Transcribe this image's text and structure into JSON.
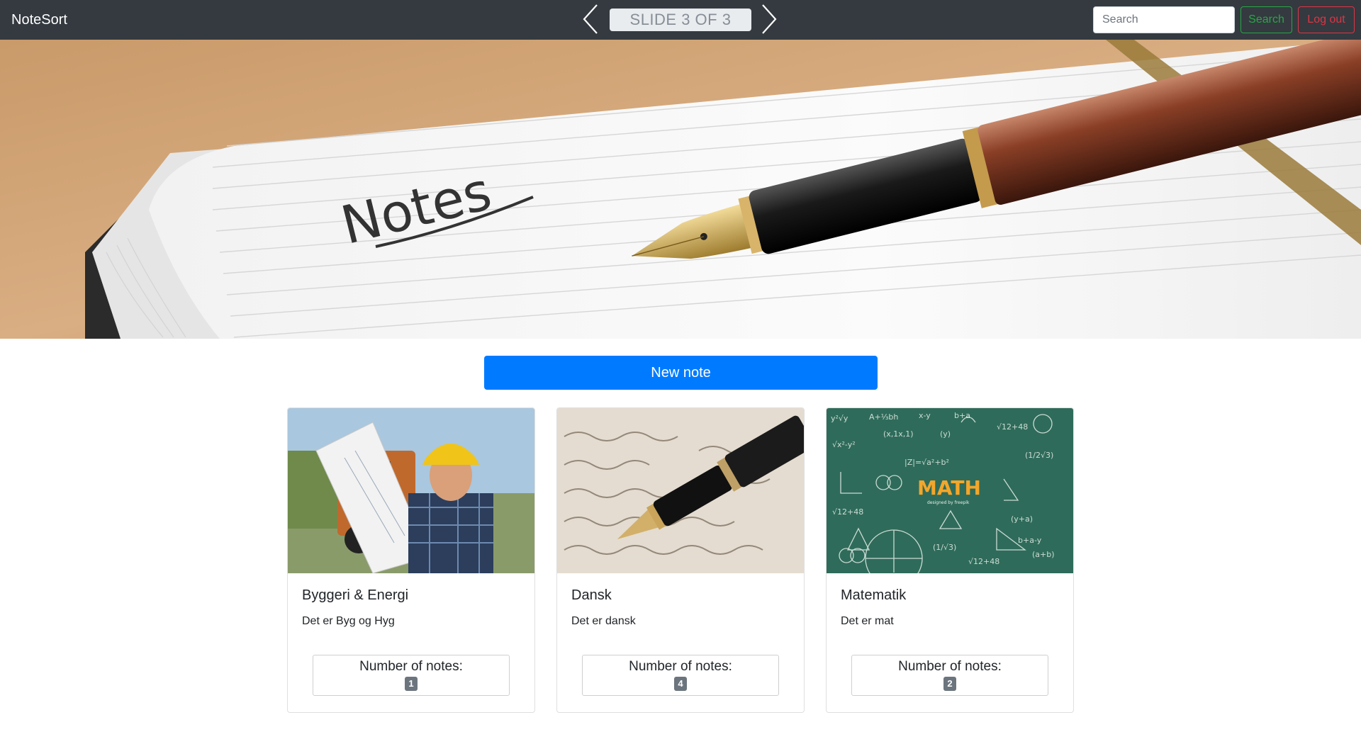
{
  "navbar": {
    "brand": "NoteSort",
    "slide_indicator": "SLIDE 3 OF 3",
    "search_placeholder": "Search",
    "search_button": "Search",
    "logout_button": "Log out",
    "prev_icon": "chevron-left-icon",
    "next_icon": "chevron-right-icon"
  },
  "hero": {
    "image": "notebook with handwritten 'Notes' and fountain pen",
    "handwriting": "Notes"
  },
  "actions": {
    "new_note": "New note"
  },
  "cards": [
    {
      "title": "Byggeri & Energi",
      "description": "Det er Byg og Hyg",
      "count_label": "Number of notes:",
      "count": "1",
      "image": "construction worker with blueprints"
    },
    {
      "title": "Dansk",
      "description": "Det er dansk",
      "count_label": "Number of notes:",
      "count": "4",
      "image": "fountain pen on handwritten letter"
    },
    {
      "title": "Matematik",
      "description": "Det er mat",
      "count_label": "Number of notes:",
      "count": "2",
      "image": "green chalkboard math formulas",
      "image_text": "MATH",
      "image_credit": "designed by freepik"
    }
  ],
  "colors": {
    "navbar_bg": "#343a40",
    "primary": "#007bff",
    "success": "#28a745",
    "danger": "#dc3545",
    "badge": "#6c757d",
    "chalkboard": "#2f6b5a"
  }
}
